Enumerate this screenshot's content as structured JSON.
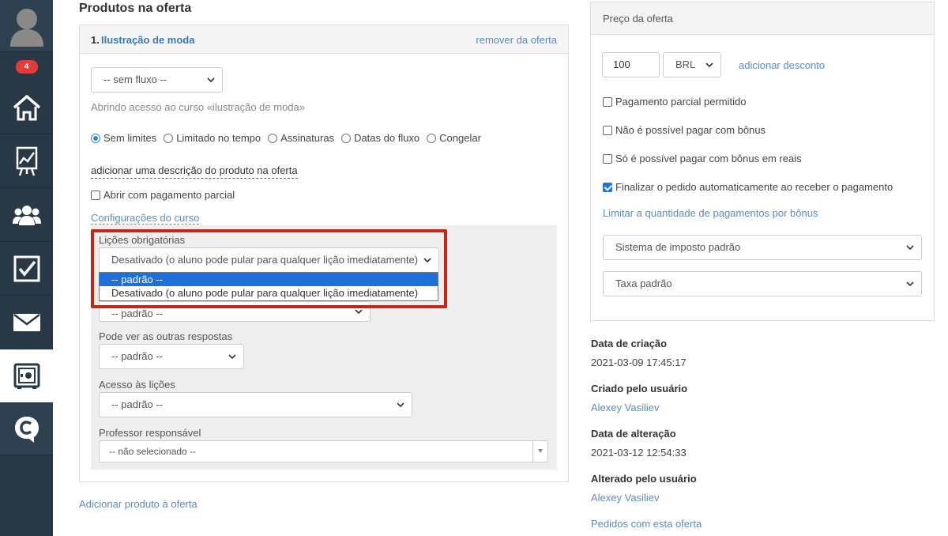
{
  "sidebar": {
    "badge_count": "4",
    "items": [
      {
        "icon": "user-avatar-icon"
      },
      {
        "icon": "home-icon"
      },
      {
        "icon": "stats-chart-icon"
      },
      {
        "icon": "users-icon"
      },
      {
        "icon": "tasks-check-icon"
      },
      {
        "icon": "mail-icon"
      },
      {
        "icon": "products-safe-icon",
        "active": true
      },
      {
        "icon": "chat-icon"
      }
    ]
  },
  "products": {
    "section_title": "Produtos na oferta",
    "item": {
      "number": "1.",
      "name": "Ilustração de moda",
      "remove_label": "remover da oferta",
      "flow_select": "-- sem fluxo --",
      "access_text": "Abrindo acesso ao curso «ilustração de moda»",
      "access_options": [
        "Sem limites",
        "Limitado no tempo",
        "Assinaturas",
        "Datas do fluxo",
        "Congelar"
      ],
      "access_selected": 0,
      "add_description": "adicionar uma descrição do produto na oferta",
      "partial_payment_label": "Abrir com pagamento parcial",
      "course_settings_link": "Configurações do curso",
      "settings": {
        "lessons_label": "Lições obrigatórias",
        "lessons_value": "Desativado (o aluno pode pular para qualquer lição imediatamente)",
        "lessons_options": [
          "-- padrão --",
          "Desativado (o aluno pode pular para qualquer lição imediatamente)"
        ],
        "hidden_value": "-- padrão --",
        "answers_label": "Pode ver as outras respostas",
        "answers_value": "-- padrão --",
        "access_label": "Acesso às lições",
        "access_value": "-- padrão --",
        "teacher_label": "Professor responsável",
        "teacher_value": "-- não selecionado --"
      }
    },
    "add_product": "Adicionar produto à oferta"
  },
  "price": {
    "title": "Preço da oferta",
    "amount": "100",
    "currency": "BRL",
    "add_discount": "adicionar desconto",
    "checkboxes": [
      {
        "label": "Pagamento parcial permitido",
        "checked": false
      },
      {
        "label": "Não é possível pagar com bônus",
        "checked": false
      },
      {
        "label": "Só é possível pagar com bônus em reais",
        "checked": false
      },
      {
        "label": "Finalizar o pedido automaticamente ao receber o pagamento",
        "checked": true
      }
    ],
    "limit_link": "Limitar a quantidade de pagamentos por bônus",
    "tax_system": "Sistema de imposto padrão",
    "tax_rate": "Taxa padrão"
  },
  "meta": {
    "created_label": "Data de criação",
    "created_value": "2021-03-09 17:45:17",
    "created_by_label": "Criado pelo usuário",
    "created_by_value": "Alexey Vasiliev",
    "changed_label": "Data de alteração",
    "changed_value": "2021-03-12 12:54:33",
    "changed_by_label": "Alterado pelo usuário",
    "changed_by_value": "Alexey Vasiliev",
    "orders_link": "Pedidos com esta oferta"
  },
  "colors": {
    "sidebar_bg": "#293846",
    "link": "#5a8cc2",
    "highlight": "#c0281a",
    "selected_option": "#1e6fd9",
    "badge": "#e43b3b"
  }
}
